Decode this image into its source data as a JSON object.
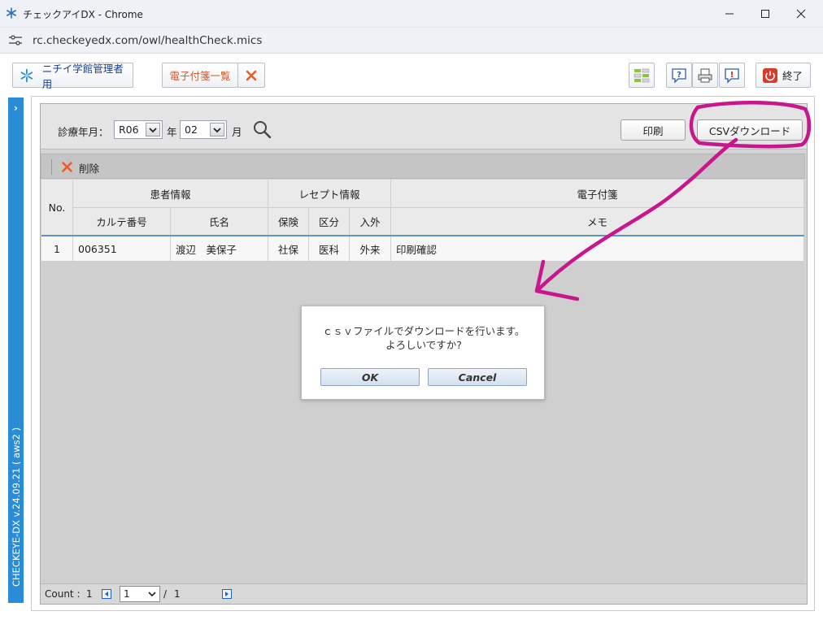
{
  "browser": {
    "window_title": "チェックアイDX - Chrome",
    "url": "rc.checkeyedx.com/owl/healthCheck.mics"
  },
  "toolbar": {
    "admin_button_label": "ニチイ学館管理者用",
    "sticky_list_label": "電子付箋一覧",
    "exit_label": "終了"
  },
  "sidebar": {
    "version_text": "CHECKEYE-DX v.24.09.21 ( aws2 )"
  },
  "search": {
    "period_label": "診療年月：",
    "year_value": "R06",
    "year_suffix": "年",
    "month_value": "02",
    "month_suffix": "月",
    "print_label": "印刷",
    "csv_label": "CSVダウンロード"
  },
  "actions": {
    "delete_label": "削除"
  },
  "table": {
    "header_no": "No.",
    "group_patient": "患者情報",
    "group_receipt": "レセプト情報",
    "group_sticky": "電子付箋",
    "col_chart_no": "カルテ番号",
    "col_name": "氏名",
    "col_insurance": "保険",
    "col_category": "区分",
    "col_inout": "入外",
    "col_memo": "メモ",
    "rows": [
      {
        "no": "1",
        "chart_no": "006351",
        "name": "渡辺　美保子",
        "insurance": "社保",
        "category": "医科",
        "inout": "外来",
        "memo": "印刷確認"
      }
    ]
  },
  "pager": {
    "count_label": "Count :",
    "count_value": "1",
    "page_value": "1",
    "page_separator": "/",
    "total_pages": "1"
  },
  "dialog": {
    "line1": "ｃｓｖファイルでダウンロードを行います。",
    "line2": "よろしいですか?",
    "ok_label": "OK",
    "cancel_label": "Cancel"
  },
  "colors": {
    "annotation": "#c8168c",
    "sidebar": "#2a8bd6"
  }
}
